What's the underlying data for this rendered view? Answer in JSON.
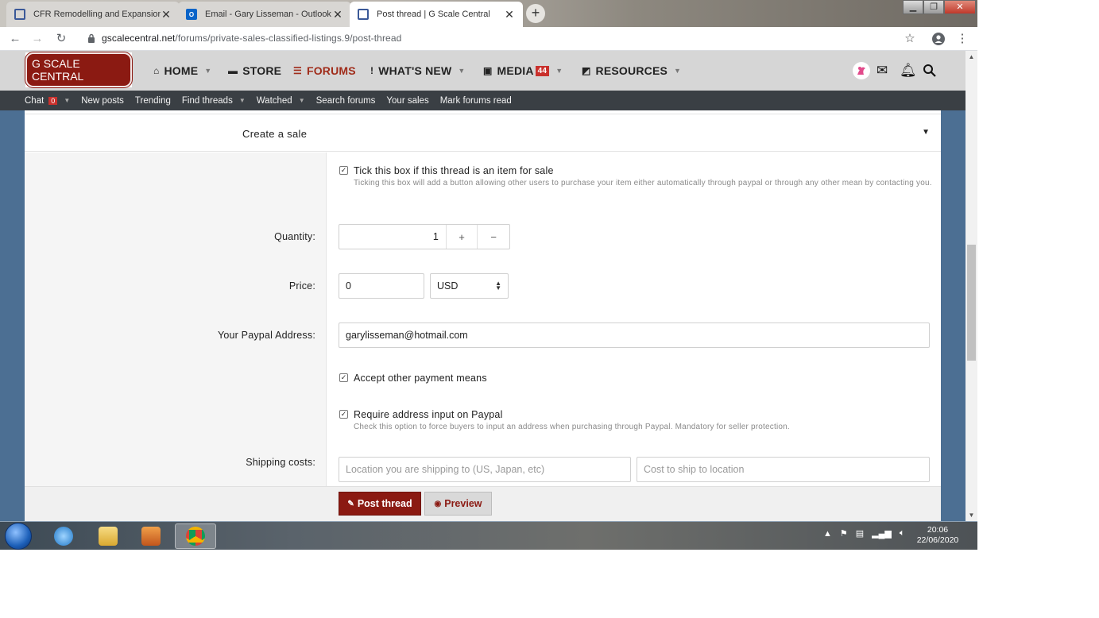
{
  "browser": {
    "tabs": [
      {
        "title": "CFR Remodelling and Expansion"
      },
      {
        "title": "Email - Gary Lisseman - Outlook"
      },
      {
        "title": "Post thread | G Scale Central"
      }
    ],
    "url_host": "gscalecentral.net",
    "url_path": "/forums/private-sales-classified-listings.9/post-thread"
  },
  "site": {
    "logo_text": "G SCALE CENTRAL",
    "nav": [
      {
        "label": "HOME"
      },
      {
        "label": "STORE"
      },
      {
        "label": "FORUMS"
      },
      {
        "label": "WHAT'S NEW"
      },
      {
        "label": "MEDIA",
        "badge": "44"
      },
      {
        "label": "RESOURCES"
      }
    ],
    "subnav": [
      {
        "label": "Chat",
        "badge": "0"
      },
      {
        "label": "New posts"
      },
      {
        "label": "Trending"
      },
      {
        "label": "Find threads"
      },
      {
        "label": "Watched"
      },
      {
        "label": "Search forums"
      },
      {
        "label": "Your sales"
      },
      {
        "label": "Mark forums read"
      }
    ]
  },
  "form": {
    "section_title": "Create a sale",
    "for_sale": {
      "label": "Tick this box if this thread is an item for sale",
      "hint": "Ticking this box will add a button allowing other users to purchase your item either automatically through paypal or through any other mean by contacting you.",
      "checked": true
    },
    "quantity": {
      "label": "Quantity:",
      "value": "1",
      "plus": "+",
      "minus": "−"
    },
    "price": {
      "label": "Price:",
      "value": "0",
      "currency": "USD"
    },
    "paypal": {
      "label": "Your Paypal Address:",
      "value": "garylisseman@hotmail.com"
    },
    "accept_other": {
      "label": "Accept other payment means",
      "checked": true
    },
    "require_address": {
      "label": "Require address input on Paypal",
      "hint": "Check this option to force buyers to input an address when purchasing through Paypal. Mandatory for seller protection.",
      "checked": true
    },
    "shipping": {
      "label": "Shipping costs:",
      "location_placeholder": "Location you are shipping to (US, Japan, etc)",
      "cost_placeholder": "Cost to ship to location"
    },
    "buttons": {
      "post": "Post thread",
      "preview": "Preview"
    }
  },
  "taskbar": {
    "time": "20:06",
    "date": "22/06/2020"
  }
}
